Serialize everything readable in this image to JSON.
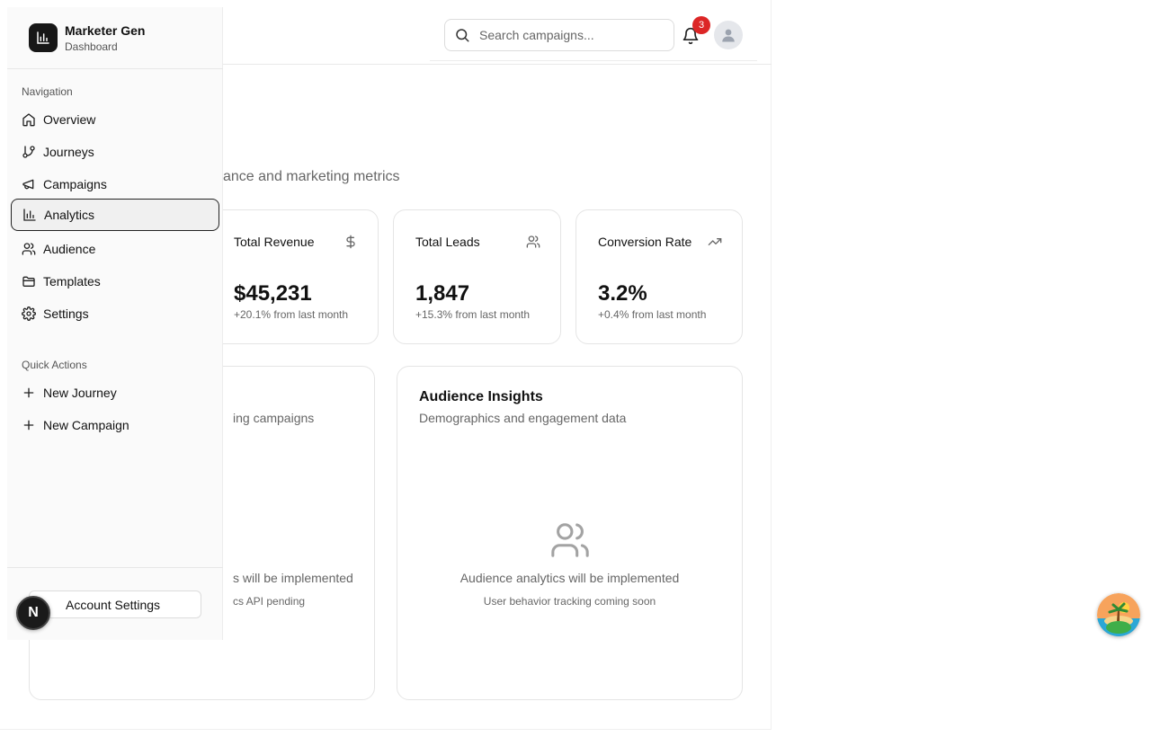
{
  "brand": {
    "name": "Marketer Gen",
    "subtitle": "Dashboard"
  },
  "header": {
    "search_placeholder": "Search campaigns...",
    "notification_count": "3"
  },
  "page": {
    "subtitle_visible": "ance and marketing metrics"
  },
  "stats": [
    {
      "title": "Total Revenue",
      "icon": "dollar-icon",
      "value": "$45,231",
      "change": "+20.1% from last month"
    },
    {
      "title": "Total Leads",
      "icon": "users-icon",
      "value": "1,847",
      "change": "+15.3% from last month"
    },
    {
      "title": "Conversion Rate",
      "icon": "trending-up-icon",
      "value": "3.2%",
      "change": "+0.4% from last month"
    }
  ],
  "panels": {
    "left": {
      "desc_visible": "ing campaigns",
      "message_visible": "s will be implemented",
      "sub_visible": "cs API pending"
    },
    "audience": {
      "title": "Audience Insights",
      "desc": "Demographics and engagement data",
      "message": "Audience analytics will be implemented",
      "sub": "User behavior tracking coming soon"
    }
  },
  "sidebar": {
    "nav_label": "Navigation",
    "items": [
      {
        "label": "Overview",
        "icon": "home-icon"
      },
      {
        "label": "Journeys",
        "icon": "git-branch-icon"
      },
      {
        "label": "Campaigns",
        "icon": "megaphone-icon"
      },
      {
        "label": "Analytics",
        "icon": "bar-chart-icon",
        "active": true
      },
      {
        "label": "Audience",
        "icon": "users-icon"
      },
      {
        "label": "Templates",
        "icon": "folder-icon"
      },
      {
        "label": "Settings",
        "icon": "gear-icon"
      }
    ],
    "quick_label": "Quick Actions",
    "quick_actions": [
      {
        "label": "New Journey",
        "icon": "plus-icon"
      },
      {
        "label": "New Campaign",
        "icon": "plus-icon"
      }
    ],
    "account_settings": "Account Settings"
  },
  "overlay": {
    "dev_badge": "N"
  }
}
